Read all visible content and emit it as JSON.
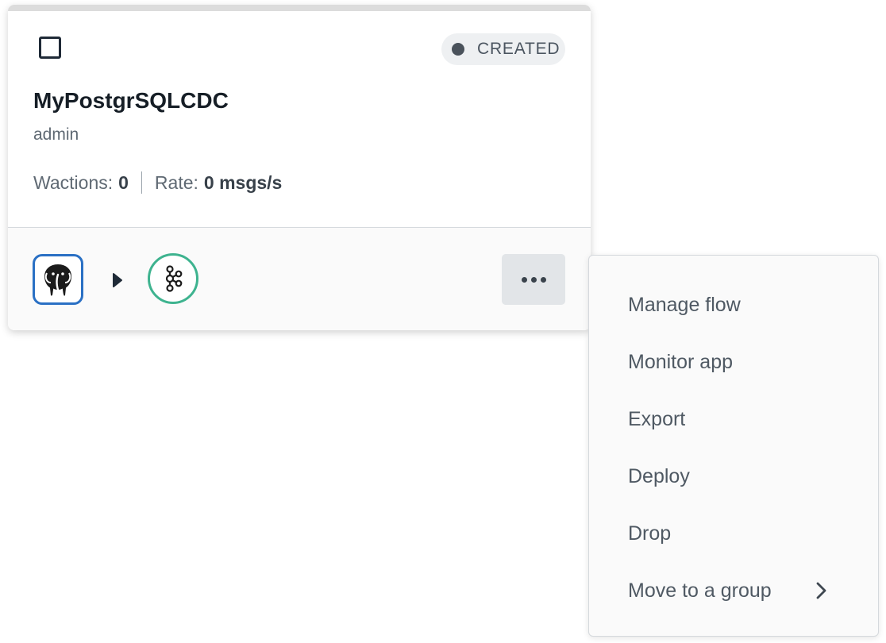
{
  "card": {
    "status": {
      "label": "CREATED",
      "dot_color": "#4a525b"
    },
    "title": "MyPostgrSQLCDC",
    "owner": "admin",
    "stats": {
      "wactions_label": "Wactions:",
      "wactions_value": "0",
      "rate_label": "Rate:",
      "rate_value": "0 msgs/s"
    },
    "flow": {
      "source_icon": "postgresql-elephant-icon",
      "source_color": "#2a70c4",
      "target_icon": "kafka-icon",
      "target_color": "#3eb38f"
    }
  },
  "menu": {
    "items": [
      {
        "label": "Manage flow"
      },
      {
        "label": "Monitor app"
      },
      {
        "label": "Export"
      },
      {
        "label": "Deploy"
      },
      {
        "label": "Drop"
      },
      {
        "label": "Move to a group",
        "has_submenu": true
      }
    ]
  }
}
